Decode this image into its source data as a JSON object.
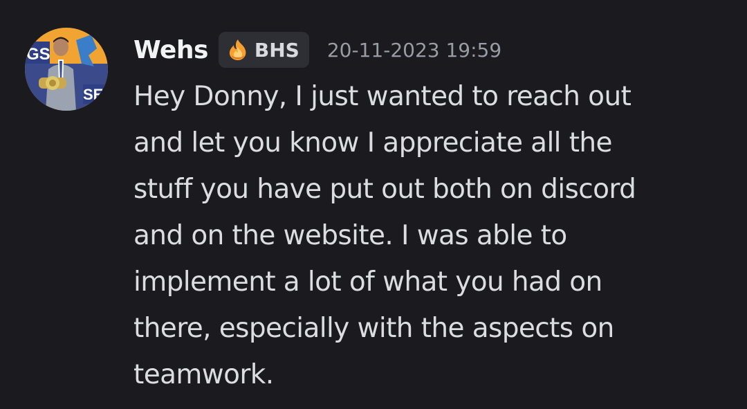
{
  "message": {
    "author": {
      "name": "Wehs",
      "avatar_icon": "user-avatar",
      "tag": {
        "icon": "flame-icon",
        "label": "BHS"
      }
    },
    "timestamp": "20-11-2023 19:59",
    "text": "Hey Donny, I just wanted to reach out\nand let you know I appreciate all the\nstuff you have put out both on discord\nand on the website. I was able to\nimplement a lot of what you had on\nthere, especially with the aspects on\nteamwork."
  },
  "colors": {
    "background": "#1b1b1f",
    "username": "#f2f3f5",
    "tag_background": "#2e2f35",
    "timestamp": "#9a9ca3",
    "message_text": "#dcdde0"
  }
}
